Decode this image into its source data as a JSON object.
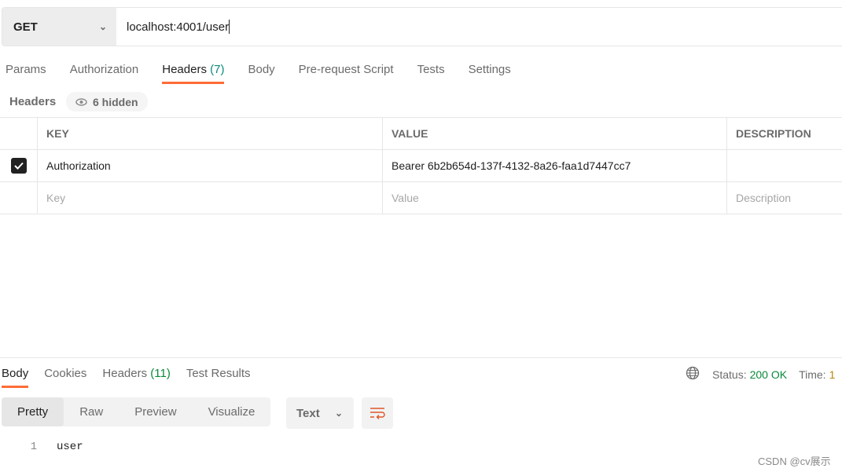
{
  "request": {
    "method": "GET",
    "url": "localhost:4001/user"
  },
  "request_tabs": [
    {
      "label": "Params"
    },
    {
      "label": "Authorization"
    },
    {
      "label": "Headers",
      "count": "(7)",
      "active": true
    },
    {
      "label": "Body"
    },
    {
      "label": "Pre-request Script"
    },
    {
      "label": "Tests"
    },
    {
      "label": "Settings"
    }
  ],
  "headers_section": {
    "title": "Headers",
    "hidden": "6 hidden"
  },
  "table": {
    "columns": [
      "KEY",
      "VALUE",
      "DESCRIPTION"
    ],
    "rows": [
      {
        "checked": true,
        "key": "Authorization",
        "value": "Bearer 6b2b654d-137f-4132-8a26-faa1d7447cc7",
        "description": ""
      }
    ],
    "placeholders": {
      "key": "Key",
      "value": "Value",
      "description": "Description"
    }
  },
  "response_tabs": [
    {
      "label": "Body",
      "active": true
    },
    {
      "label": "Cookies"
    },
    {
      "label": "Headers",
      "count": "(11)"
    },
    {
      "label": "Test Results"
    }
  ],
  "status": {
    "label": "Status:",
    "value": "200 OK",
    "time_label": "Time:",
    "time_value": "1"
  },
  "view_modes": [
    "Pretty",
    "Raw",
    "Preview",
    "Visualize"
  ],
  "format": "Text",
  "body_lines": [
    {
      "n": "1",
      "text": "user"
    }
  ],
  "watermark": "CSDN @cv展示",
  "colors": {
    "accent": "#ff6c37",
    "status_ok": "#0a8a3a",
    "count": "#0a8a7a"
  }
}
